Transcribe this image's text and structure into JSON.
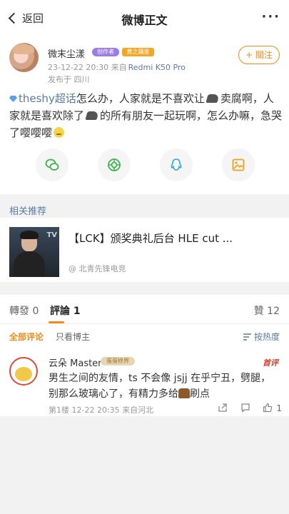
{
  "nav": {
    "back_label": "返回",
    "title": "微博正文",
    "more": "···"
  },
  "post": {
    "username": "微末尘漾",
    "badge_creator": "创作者",
    "badge_fan": "黄之踊鉴",
    "follow_label": "+ 關注",
    "time": "23-12-22 20:30",
    "source_prefix": "来自",
    "device": "Redmi K50 Pro",
    "location": "发布于 四川",
    "text_topic": "theshy超话",
    "text_part1": "怎么办，人家就是不喜欢让",
    "text_part2": "卖腐啊，人家就是喜欢除了",
    "text_part3": "的所有朋友一起玩啊，怎么办嘛，急哭了嘤嘤嘤",
    "share_icons": [
      "wechat-icon",
      "moments-icon",
      "qq-icon",
      "save-image-icon"
    ]
  },
  "recommend": {
    "section_title": "相关推荐",
    "title": "【LCK】颁奖典礼后台 HLE cut ...",
    "thumb_tag": "TV",
    "source": "@ 北青先锋电竞"
  },
  "tabs": {
    "repost": "轉發 0",
    "comment": "評論 1",
    "like": "贊 12"
  },
  "filters": {
    "all": "全部评论",
    "author_only": "只看博主",
    "sort": "按热度"
  },
  "comment": {
    "username": "云朵 Master",
    "badge": "蛋蛋修界",
    "first_tag": "首评",
    "text_part1": "男生之间的友情，ts 不会像 jsjj 在乎宁丑，劈腿，别那么玻璃心了，有精力多给",
    "text_part2": "刷点",
    "meta": "第1楼  12-22 20:35  来自河北",
    "like_count": "1"
  },
  "colors": {
    "accent": "#f28b1c",
    "link": "#5a7aa8",
    "first_comment": "#e03a2a"
  }
}
